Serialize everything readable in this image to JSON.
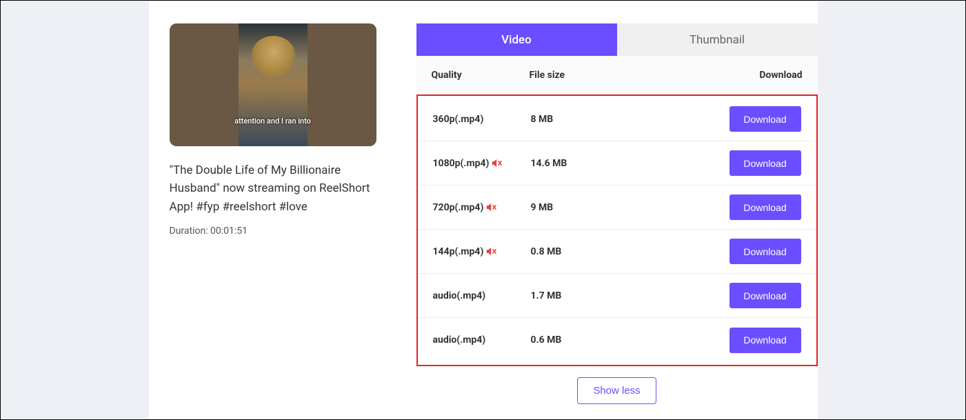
{
  "video": {
    "title": "\"The Double Life of My Billionaire Husband\" now streaming on ReelShort App! #fyp #reelshort #love",
    "caption_overlay": "attention and I ran into",
    "duration_label": "Duration: 00:01:51"
  },
  "tabs": {
    "video": "Video",
    "thumbnail": "Thumbnail"
  },
  "table": {
    "header_quality": "Quality",
    "header_size": "File size",
    "header_download": "Download"
  },
  "rows": [
    {
      "quality": "360p(.mp4)",
      "muted": false,
      "size": "8 MB",
      "button": "Download"
    },
    {
      "quality": "1080p(.mp4)",
      "muted": true,
      "size": "14.6 MB",
      "button": "Download"
    },
    {
      "quality": "720p(.mp4)",
      "muted": true,
      "size": "9 MB",
      "button": "Download"
    },
    {
      "quality": "144p(.mp4)",
      "muted": true,
      "size": "0.8 MB",
      "button": "Download"
    },
    {
      "quality": "audio(.mp4)",
      "muted": false,
      "size": "1.7 MB",
      "button": "Download"
    },
    {
      "quality": "audio(.mp4)",
      "muted": false,
      "size": "0.6 MB",
      "button": "Download"
    }
  ],
  "show_less": "Show less",
  "colors": {
    "accent": "#6b4eff",
    "highlight_border": "#e02424",
    "mute_icon": "#e04545"
  }
}
